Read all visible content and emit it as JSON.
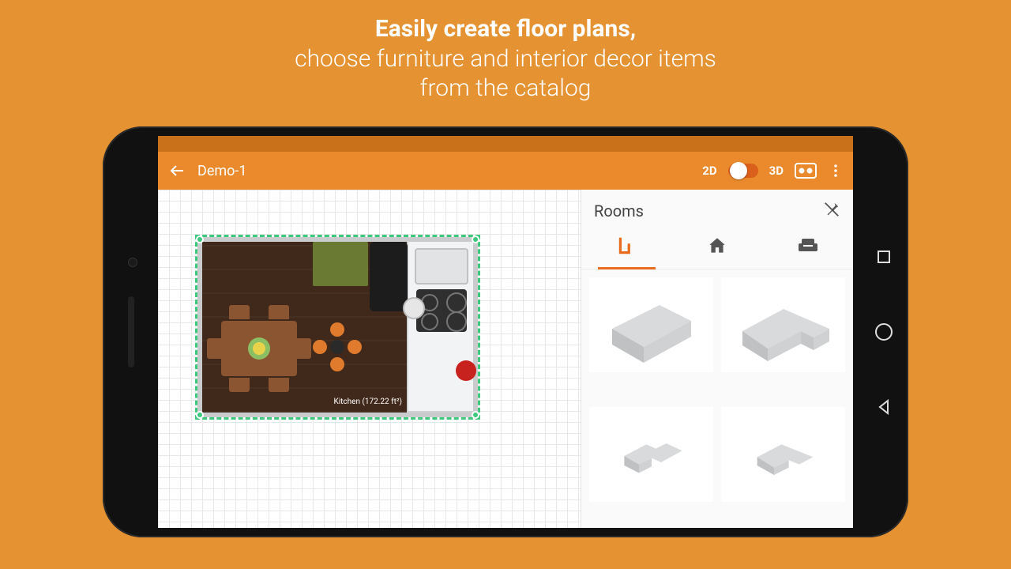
{
  "headline": {
    "bold": "Easily create floor plans,",
    "line2": "choose furniture and interior decor items",
    "line3": "from the catalog"
  },
  "appbar": {
    "title": "Demo-1",
    "mode2d": "2D",
    "mode3d": "3D"
  },
  "canvas": {
    "room_label": "Kitchen (172.22 ft²)"
  },
  "panel": {
    "title": "Rooms",
    "tabs": {
      "rooms": "rooms",
      "home": "home",
      "furniture": "furniture"
    }
  }
}
